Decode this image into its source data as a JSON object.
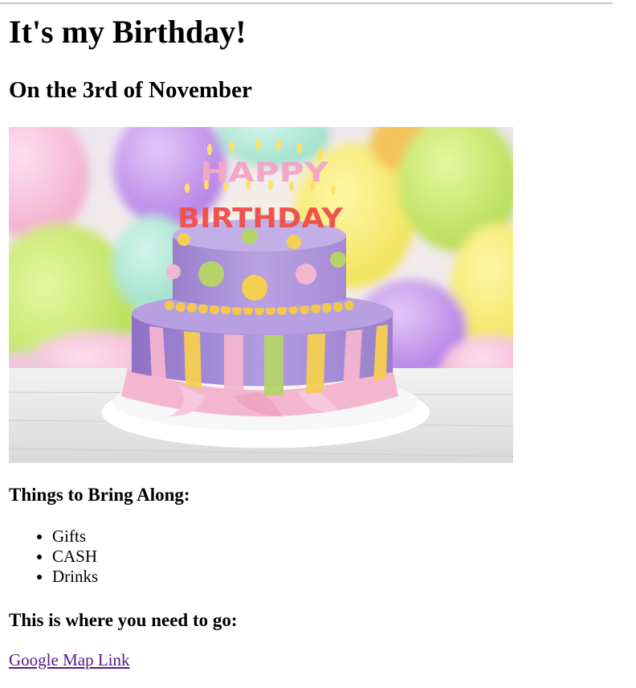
{
  "page": {
    "title": "It's my Birthday!",
    "subtitle": "On the 3rd of November"
  },
  "photo": {
    "cake_text_top": "HAPPY",
    "cake_text_bottom": "BIRTHDAY"
  },
  "bring": {
    "heading": "Things to Bring Along:",
    "items": [
      "Gifts",
      "CASH",
      "Drinks"
    ]
  },
  "directions": {
    "heading": "This is where you need to go:",
    "link_text": "Google Map Link"
  },
  "colors": {
    "link_visited": "#551a8b",
    "cake_purple": "#a88fd6",
    "frosting_pink": "#f4b6cf",
    "accent_yellow": "#f5cf52",
    "accent_green": "#b6d36a"
  }
}
